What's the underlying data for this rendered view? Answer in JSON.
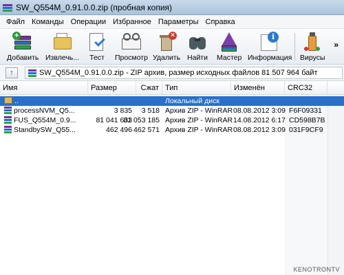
{
  "window": {
    "title": "SW_Q554M_0.91.0.0.zip (пробная копия)"
  },
  "menu": {
    "items": [
      "Файл",
      "Команды",
      "Операции",
      "Избранное",
      "Параметры",
      "Справка"
    ]
  },
  "toolbar": {
    "add": "Добавить",
    "extract": "Извлечь...",
    "test": "Тест",
    "view": "Просмотр",
    "delete": "Удалить",
    "find": "Найти",
    "wizard": "Мастер",
    "info": "Информация",
    "virus": "Вирусы",
    "more": "»"
  },
  "address": {
    "up_icon": "up-arrow-icon",
    "text": "SW_Q554M_0.91.0.0.zip - ZIP архив, размер исходных файлов 81 507 964 байт"
  },
  "columns": {
    "name": "Имя",
    "size": "Размер",
    "packed": "Сжат",
    "type": "Тип",
    "modified": "Изменён",
    "crc": "CRC32"
  },
  "rows": [
    {
      "name": "..",
      "size": "",
      "packed": "",
      "type": "Локальный диск",
      "modified": "",
      "crc": ""
    },
    {
      "name": "processNVM_Q5...",
      "size": "3 835",
      "packed": "3 518",
      "type": "Архив ZIP - WinRAR",
      "modified": "08.08.2012 3:09",
      "crc": "F6F09331"
    },
    {
      "name": "FUS_Q554M_0.9...",
      "size": "81 041 633",
      "packed": "81 053 185",
      "type": "Архив ZIP - WinRAR",
      "modified": "14.08.2012 6:17",
      "crc": "CD598B7B"
    },
    {
      "name": "StandbySW_Q55...",
      "size": "462 496",
      "packed": "462 571",
      "type": "Архив ZIP - WinRAR",
      "modified": "08.08.2012 3:09",
      "crc": "031F9CF9"
    }
  ],
  "watermark": "KENOTRONTV",
  "colors": {
    "selection": "#2a6fc9",
    "titlebar": "#b7cde2"
  }
}
